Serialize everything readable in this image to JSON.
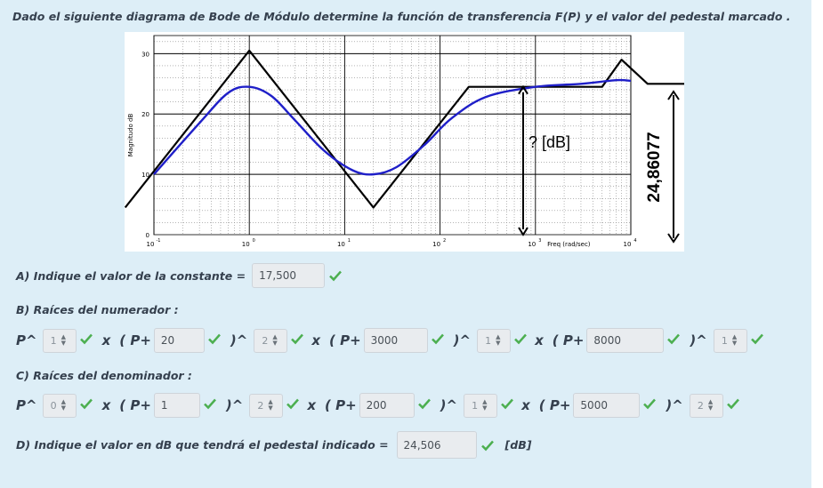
{
  "question": {
    "title": "Dado el siguiente diagrama de Bode de Módulo determine la función de transferencia F(P) y el valor del pedestal marcado ."
  },
  "chart_data": {
    "type": "line",
    "ylabel": "Magnitudo dB",
    "xlabel": "Freq (rad/sec)",
    "x_scale": "log",
    "xlim": [
      0.1,
      10000
    ],
    "ylim": [
      0,
      33
    ],
    "y_ticks": [
      "0",
      "10",
      "20",
      "30"
    ],
    "x_tick_mantissa": "10",
    "x_tick_exponents": [
      "-1",
      "0",
      "1",
      "2",
      "3",
      "4"
    ],
    "series": [
      {
        "style": "asymptotic",
        "color": "#000000",
        "points": [
          [
            0.05,
            4.5
          ],
          [
            1,
            30.5
          ],
          [
            20,
            4.5
          ],
          [
            200,
            24.5
          ],
          [
            5000,
            24.5
          ],
          [
            8000,
            29
          ],
          [
            15000,
            25
          ],
          [
            40000,
            25
          ]
        ]
      },
      {
        "style": "real",
        "color": "#1f1fc8",
        "points": [
          [
            0.1,
            10
          ],
          [
            0.3,
            18.5
          ],
          [
            0.6,
            23.5
          ],
          [
            1,
            24.5
          ],
          [
            1.7,
            23
          ],
          [
            3,
            19
          ],
          [
            6,
            14
          ],
          [
            12,
            10.7
          ],
          [
            20,
            10
          ],
          [
            35,
            11.2
          ],
          [
            70,
            15
          ],
          [
            130,
            19.2
          ],
          [
            300,
            22.8
          ],
          [
            1000,
            24.5
          ],
          [
            3000,
            25
          ],
          [
            7000,
            25.6
          ],
          [
            10000,
            25.5
          ]
        ]
      }
    ],
    "annotations": {
      "pedestal_label": "? [dB]",
      "pedestal_value": "24,86077"
    }
  },
  "answers": {
    "a_label": "A) Indique el valor de la constante =",
    "a_value": "17,500",
    "b_label": "B) Raíces del numerador :",
    "c_label": "C) Raíces del denominador :",
    "d_label": "D) Indique el valor en dB que tendrá el pedestal indicado =",
    "d_value": "24,506",
    "d_unit": "[dB]",
    "p_text": "P^",
    "x_text": "x",
    "paren_close": ")^",
    "numerator": {
      "p_exp": "1",
      "roots": [
        {
          "prefix": "( P+",
          "value": "20",
          "exp": "2"
        },
        {
          "prefix": "( P+",
          "value": "3000",
          "exp": "1"
        },
        {
          "prefix": "( P+",
          "value": "8000",
          "exp": "1"
        }
      ]
    },
    "denominator": {
      "p_exp": "0",
      "roots": [
        {
          "prefix": "( P+",
          "value": "1",
          "exp": "2"
        },
        {
          "prefix": "( P+",
          "value": "200",
          "exp": "1"
        },
        {
          "prefix": "( P+",
          "value": "5000",
          "exp": "2"
        }
      ]
    }
  },
  "colors": {
    "check": "#4caf50",
    "panel": "#ddeef7",
    "label": "#35404e"
  }
}
